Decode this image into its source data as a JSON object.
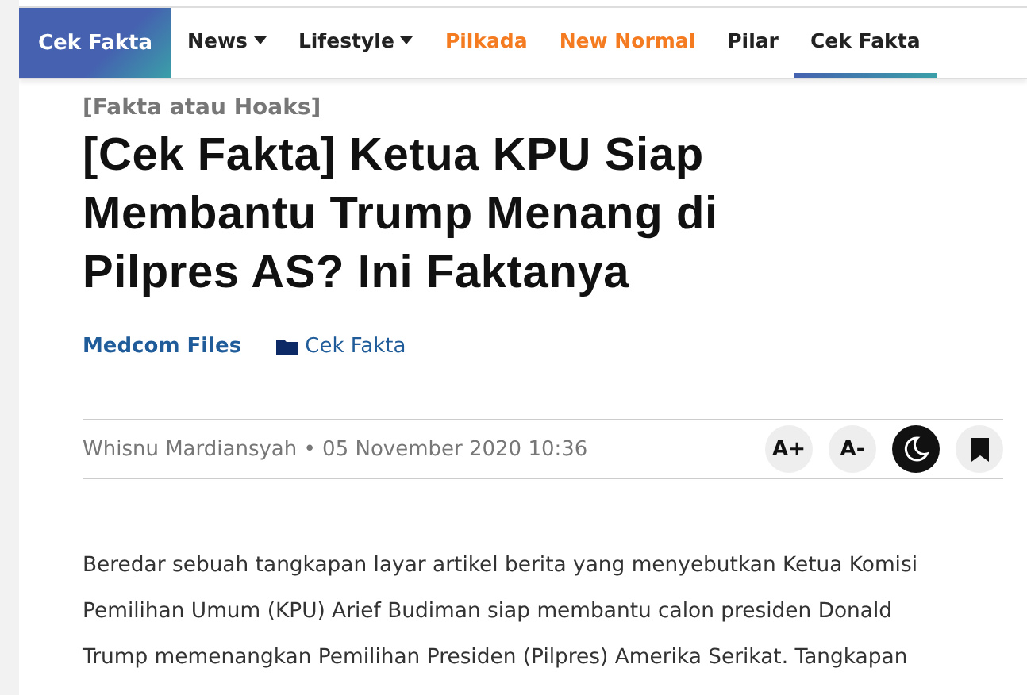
{
  "brand": "Cek Fakta",
  "nav": [
    {
      "label": "News",
      "dropdown": true,
      "selected": false,
      "color": "#222222"
    },
    {
      "label": "Lifestyle",
      "dropdown": true,
      "selected": false,
      "color": "#222222"
    },
    {
      "label": "Pilkada",
      "dropdown": false,
      "selected": false,
      "color": "#f47b20"
    },
    {
      "label": "New Normal",
      "dropdown": false,
      "selected": false,
      "color": "#f47b20"
    },
    {
      "label": "Pilar",
      "dropdown": false,
      "selected": false,
      "color": "#222222"
    },
    {
      "label": "Cek Fakta",
      "dropdown": false,
      "selected": true,
      "color": "#222222"
    }
  ],
  "article": {
    "kicker": "[Fakta atau Hoaks]",
    "title": "[Cek Fakta] Ketua KPU Siap Membantu Trump Menang di Pilpres AS? Ini Faktanya",
    "source": "Medcom Files",
    "category": "Cek Fakta",
    "byline": "Whisnu Mardiansyah • 05 November 2020 10:36",
    "tools": [
      {
        "kind": "text",
        "label": "A+"
      },
      {
        "kind": "text",
        "label": "A-"
      },
      {
        "kind": "night",
        "on": true
      },
      {
        "kind": "bookmark"
      }
    ],
    "body_lines": [
      "Beredar sebuah tangkapan layar artikel berita yang menyebutkan Ketua Komisi",
      "Pemilihan Umum (KPU) Arief Budiman siap membantu calon presiden Donald",
      "Trump memenangkan Pemilihan Presiden (Pilpres) Amerika Serikat. Tangkapan"
    ]
  }
}
